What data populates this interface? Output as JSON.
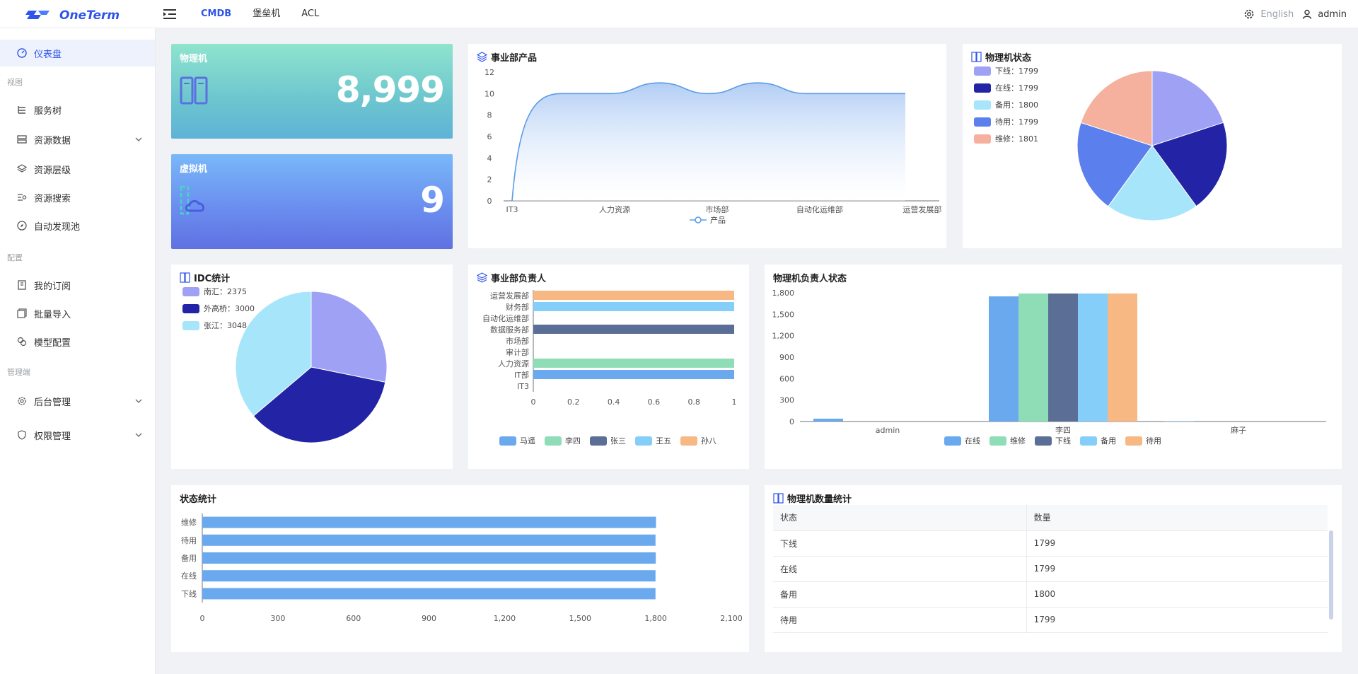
{
  "app": {
    "name": "OneTerm"
  },
  "topnav": {
    "items": [
      "CMDB",
      "堡垒机",
      "ACL"
    ],
    "active": 0
  },
  "topright": {
    "language": "English",
    "user": "admin"
  },
  "sidebar": {
    "dashboard": "仪表盘",
    "group_view": "视图",
    "service_tree": "服务树",
    "resource_data": "资源数据",
    "resource_hierarchy": "资源层级",
    "resource_search": "资源搜索",
    "auto_discovery": "自动发现池",
    "group_config": "配置",
    "my_subscriptions": "我的订阅",
    "batch_import": "批量导入",
    "model_config": "模型配置",
    "group_admin": "管理端",
    "backend_admin": "后台管理",
    "permission_admin": "权限管理"
  },
  "stats": {
    "physical": {
      "title": "物理机",
      "value": "8,999"
    },
    "virtual": {
      "title": "虚拟机",
      "value": "9"
    }
  },
  "colors": {
    "blue": "#6aa9ee",
    "green": "#8fddb7",
    "slate": "#5b6e96",
    "sky": "#86cefa",
    "orange": "#f7b884",
    "lavender": "#9fa1f5",
    "navy": "#2323a5",
    "aqua": "#a7e6fa",
    "royal": "#5b7fec",
    "salmon": "#f5b19d",
    "accent": "#2f54eb"
  },
  "chart_data": [
    {
      "id": "dept_products",
      "type": "area",
      "title": "事业部产品",
      "categories": [
        "IT3",
        "人力资源",
        "市场部",
        "自动化运维部",
        "运营发展部"
      ],
      "x": [
        0,
        0.5,
        1,
        1.5,
        2,
        2.5,
        3,
        3.5,
        4
      ],
      "values": [
        0,
        10,
        10,
        11,
        10,
        11,
        10,
        10,
        10
      ],
      "yticks": [
        0,
        2,
        4,
        6,
        8,
        10,
        12
      ],
      "ylim": [
        0,
        12
      ],
      "series": [
        {
          "name": "产品"
        }
      ]
    },
    {
      "id": "physical_status",
      "type": "pie",
      "title": "物理机状态",
      "labels": [
        "下线",
        "在线",
        "备用",
        "待用",
        "维修"
      ],
      "values": [
        1799,
        1799,
        1800,
        1799,
        1801
      ],
      "legend": [
        "下线：1799",
        "在线：1799",
        "备用：1800",
        "待用：1799",
        "维修：1801"
      ],
      "colors": [
        "#9fa1f5",
        "#2323a5",
        "#a7e6fa",
        "#5b7fec",
        "#f5b19d"
      ]
    },
    {
      "id": "idc",
      "type": "pie",
      "title": "IDC统计",
      "labels": [
        "南汇",
        "外高桥",
        "张江"
      ],
      "values": [
        2375,
        3000,
        3048
      ],
      "legend": [
        "南汇：2375",
        "外高桥：3000",
        "张江：3048"
      ],
      "colors": [
        "#9fa1f5",
        "#2323a5",
        "#a7e6fa"
      ]
    },
    {
      "id": "dept_owner",
      "type": "bar",
      "orientation": "horizontal",
      "title": "事业部负责人",
      "categories": [
        "运营发展部",
        "财务部",
        "自动化运维部",
        "数据服务部",
        "市场部",
        "审计部",
        "人力资源",
        "IT部",
        "IT3"
      ],
      "bar_values": [
        1,
        1,
        0,
        1,
        0,
        0,
        1,
        1,
        0
      ],
      "bar_series": [
        4,
        3,
        0,
        2,
        0,
        0,
        1,
        0,
        0
      ],
      "xticks": [
        "0",
        "0.2",
        "0.4",
        "0.6",
        "0.8",
        "1"
      ],
      "xlim": [
        0,
        1
      ],
      "series": [
        {
          "name": "马遥"
        },
        {
          "name": "李四"
        },
        {
          "name": "张三"
        },
        {
          "name": "王五"
        },
        {
          "name": "孙八"
        }
      ]
    },
    {
      "id": "owner_status",
      "type": "bar",
      "title": "物理机负责人状态",
      "categories": [
        "admin",
        "李四",
        "麻子"
      ],
      "yticks": [
        "0",
        "300",
        "600",
        "900",
        "1,200",
        "1,500",
        "1,800"
      ],
      "ylim": [
        0,
        1800
      ],
      "series": [
        {
          "name": "在线",
          "values": [
            40,
            1750,
            5
          ]
        },
        {
          "name": "维修",
          "values": [
            0,
            1790,
            0
          ]
        },
        {
          "name": "下线",
          "values": [
            0,
            1790,
            0
          ]
        },
        {
          "name": "备用",
          "values": [
            0,
            1790,
            0
          ]
        },
        {
          "name": "待用",
          "values": [
            0,
            1790,
            0
          ]
        }
      ]
    },
    {
      "id": "status_stats",
      "type": "bar",
      "orientation": "horizontal",
      "title": "状态统计",
      "categories": [
        "维修",
        "待用",
        "备用",
        "在线",
        "下线"
      ],
      "values": [
        1801,
        1799,
        1800,
        1799,
        1799
      ],
      "xticks": [
        "0",
        "300",
        "600",
        "900",
        "1,200",
        "1,500",
        "1,800",
        "2,100"
      ],
      "xlim": [
        0,
        2100
      ]
    }
  ],
  "count_table": {
    "title": "物理机数量统计",
    "columns": [
      "状态",
      "数量"
    ],
    "rows": [
      [
        "下线",
        "1799"
      ],
      [
        "在线",
        "1799"
      ],
      [
        "备用",
        "1800"
      ],
      [
        "待用",
        "1799"
      ]
    ]
  }
}
